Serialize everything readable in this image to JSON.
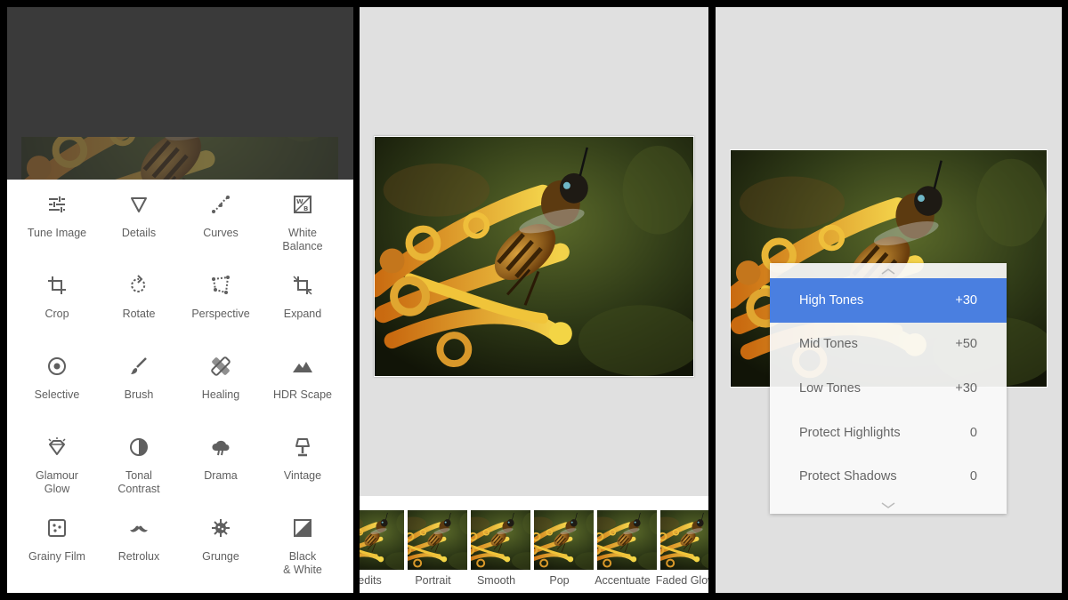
{
  "tools_panel": {
    "tools": [
      {
        "label": "Tune Image",
        "icon": "sliders-icon"
      },
      {
        "label": "Details",
        "icon": "triangle-down-icon"
      },
      {
        "label": "Curves",
        "icon": "curves-icon"
      },
      {
        "label": "White\nBalance",
        "icon": "white-balance-icon"
      },
      {
        "label": "Crop",
        "icon": "crop-icon"
      },
      {
        "label": "Rotate",
        "icon": "rotate-icon"
      },
      {
        "label": "Perspective",
        "icon": "perspective-icon"
      },
      {
        "label": "Expand",
        "icon": "expand-icon"
      },
      {
        "label": "Selective",
        "icon": "target-icon"
      },
      {
        "label": "Brush",
        "icon": "brush-icon"
      },
      {
        "label": "Healing",
        "icon": "bandage-icon"
      },
      {
        "label": "HDR Scape",
        "icon": "mountains-icon"
      },
      {
        "label": "Glamour\nGlow",
        "icon": "diamond-icon"
      },
      {
        "label": "Tonal\nContrast",
        "icon": "tonal-contrast-icon"
      },
      {
        "label": "Drama",
        "icon": "cloud-icon"
      },
      {
        "label": "Vintage",
        "icon": "lamp-icon"
      },
      {
        "label": "Grainy Film",
        "icon": "grain-icon"
      },
      {
        "label": "Retrolux",
        "icon": "mustache-icon"
      },
      {
        "label": "Grunge",
        "icon": "grunge-icon"
      },
      {
        "label": "Black\n& White",
        "icon": "black-white-icon"
      }
    ]
  },
  "looks_panel": {
    "looks": [
      "edits",
      "Portrait",
      "Smooth",
      "Pop",
      "Accentuate",
      "Faded Glow"
    ]
  },
  "tune_panel": {
    "rows": [
      {
        "label": "High Tones",
        "value": "+30",
        "active": true
      },
      {
        "label": "Mid Tones",
        "value": "+50",
        "active": false
      },
      {
        "label": "Low Tones",
        "value": "+30",
        "active": false
      },
      {
        "label": "Protect Highlights",
        "value": "0",
        "active": false
      },
      {
        "label": "Protect Shadows",
        "value": "0",
        "active": false
      }
    ]
  },
  "colors": {
    "accent": "#4a7fe0",
    "panel_bg": "#e0e0e0",
    "dark_bg": "#3a3a3a",
    "icon_gray": "#5f5f5f"
  }
}
